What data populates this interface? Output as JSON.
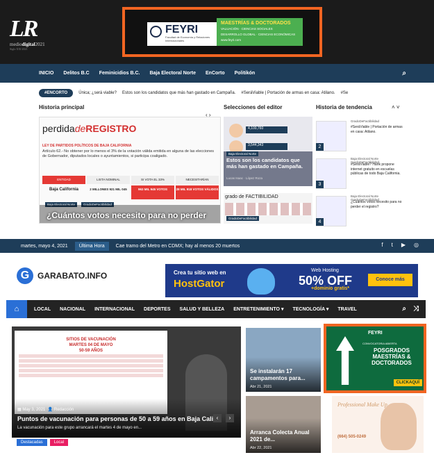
{
  "site1": {
    "logo": {
      "mark": "LR",
      "sub_a": "medio",
      "sub_b": "digital",
      "sub_c": "2021",
      "tagline": "Siglo XXI 2021"
    },
    "ad": {
      "brand": "FEYRI",
      "brand_sub": "Facultad de Economía y Relaciones Internacionales",
      "headline": "MAESTRÍAS & DOCTORADOS",
      "line1": "VALUACIÓN · CIENCIAS SOCIALES",
      "line2": "DESARROLLO GLOBAL · CIENCIAS ECONÓMICAS",
      "site": "www.feyri.com"
    },
    "nav": [
      "INICIO",
      "Delitos B.C",
      "Feminicidios B.C.",
      "Baja Electoral Norte",
      "EnCorto",
      "Politikón"
    ],
    "ticker": {
      "badge": "#ENCORTO",
      "items": [
        "Única; ¿será viable?",
        "Estos son los candidatos que más han gastado en Campaña.",
        "#SeráViable | Portación de armas en casa: Atilano.",
        "#Se"
      ]
    },
    "sections": {
      "main": "Historia principal",
      "editor": "Selecciones del editor",
      "trend": "Historia de tendencia"
    },
    "main_story": {
      "title_a": "perdida",
      "title_b": "de",
      "title_c": "REGISTRO",
      "law": "LEY DE PARTIDOS POLÍTICOS DE BAJA CALIFORNIA",
      "article": "Artículo 62.- No obtener por lo menos el 3% de la votación válida emitida en alguna de las elecciones de Gobernador, diputados locales o ayuntamientos, si participa coaligado.",
      "table": {
        "headers": [
          "ENTIDAD",
          "LISTA NOMINAL",
          "SI VOTA EL 33%",
          "NECESITARÍAN"
        ],
        "state": "Baja California",
        "v1": "2 MILLONES 921 MIL 045",
        "v2": "963 MIL 945 VOTOS",
        "v3": "28 MIL 918 VOTOS VÁLIDOS"
      },
      "tags": [
        "Baja Electoral Norte",
        "GradoDeFactibilidad"
      ],
      "headline": "¿Cuántos votos necesito para no perder"
    },
    "editor_pick": {
      "title": "Estos son los candidatos que más han gastado en Campaña.",
      "tag": "Baja Electoral Norte",
      "meta": "Lucas Isaac · López Roza",
      "num1": "4,100,760",
      "num2": "3,544,343",
      "grado": "grado de FACTIBILIDAD",
      "grado_tag": "GradoDeFactibilidad"
    },
    "trending": [
      {
        "num": "2",
        "src": "GradoDeFactibilidad",
        "title": "#SeráViable | Portación de armas en casa: Atilano."
      },
      {
        "num": "3",
        "src": "Baja Electoral Norte GradoDeFactibilidad",
        "title": "#SeráViable? Hank propone internet gratuito en escuelas públicas de todo Baja California."
      },
      {
        "num": "4",
        "src": "Baja Electoral Norte GradoDeFactibilidad",
        "title": "¿Cuántos votos necesito para no perder el registro?"
      }
    ]
  },
  "site2": {
    "topbar": {
      "date": "martes, mayo 4, 2021",
      "hot": "Última Hora",
      "headline": "Cae tramo del Metro en CDMX; hay al menos 20 muertos"
    },
    "logo": {
      "letter": "G",
      "name": "GARABATO.INFO"
    },
    "hostgator": {
      "a": "Crea tu sitio web en",
      "b": "HostGator",
      "c": "Web Hosting",
      "d": "50% OFF",
      "e": "+dominio gratis*",
      "btn": "Conoce más"
    },
    "nav": [
      "LOCAL",
      "NACIONAL",
      "INTERNACIONAL",
      "DEPORTES",
      "SALUD Y BELLEZA",
      "ENTRETENIMIENTO ▾",
      "TECNOLOGÍA ▾",
      "TRAVEL"
    ],
    "featured": {
      "screen_title": "SITIOS DE VACUNACIÓN",
      "screen_sub": "MARTES 04 DE MAYO",
      "screen_age": "50-59 AÑOS",
      "date": "May 3, 2021",
      "author": "Redacción",
      "title": "Puntos de vacunación para personas de 50 a 59 años en Baja California",
      "sub": "La vacunación para este grupo arrancará el martes 4 de mayo en..."
    },
    "tags": [
      "Destacadas",
      "Local"
    ],
    "card_a": {
      "title": "Se instalarán 17 campamentos para...",
      "date": "Abr 21, 2021"
    },
    "card_b": {
      "title": "Arranca Colecta Anual 2021 de...",
      "date": "Abr 22, 2021"
    },
    "feyri2": {
      "brand": "FEYRI",
      "conv": "CONVOCATORIA ABIERTA",
      "pos": "POSGRADOS MAESTRÍAS & DOCTORADOS",
      "click": "CLICKAQUÍ"
    },
    "makeup": {
      "title": "Professional Make Up",
      "phone": "(664) 505-0249"
    },
    "colors": {
      "navy": "#1e3d59",
      "orange": "#f26522",
      "blue": "#2a6fd6",
      "green": "#0e6b3e",
      "red": "#d32f2f"
    }
  }
}
